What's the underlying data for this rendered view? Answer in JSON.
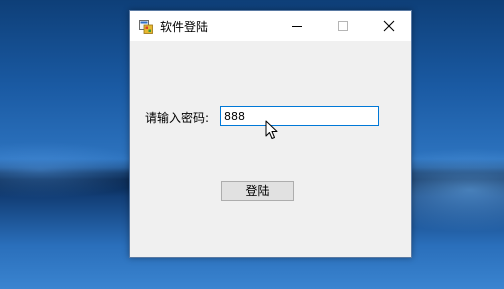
{
  "window": {
    "title": "软件登陆",
    "app_icon": "winforms-app-icon",
    "controls": [
      "minimize-icon",
      "maximize-icon",
      "close-icon"
    ]
  },
  "form": {
    "password_label": "请输入密码:",
    "password_value": "888",
    "login_label": "登陆"
  },
  "colors": {
    "window_bg": "#f0f0f0",
    "titlebar_bg": "#ffffff",
    "input_focus_border": "#0078d7",
    "button_bg": "#e1e1e1",
    "desktop_accent": "#1a5aa3"
  },
  "cursor": "arrow-pointer-icon"
}
